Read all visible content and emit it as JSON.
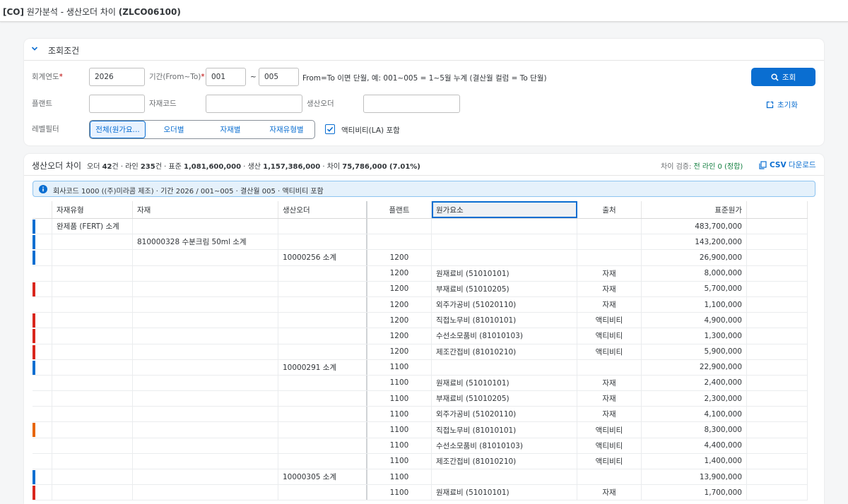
{
  "header": {
    "title_prefix": "[CO]",
    "title_main": " 원가분석 - 생산오더 차이 ",
    "title_code": "(ZLCO06100)"
  },
  "filters": {
    "section_title": "조회조건",
    "fiscal_year_label": "회계연도",
    "fiscal_year_value": "2026",
    "period_label": "기간(From~To)",
    "period_from": "001",
    "period_sep": "~",
    "period_to": "005",
    "period_hint": "From=To 이면 단월, 예: 001~005 = 1~5월 누계 (결산월 컬럼 = To 단월)",
    "plant_label": "플랜트",
    "plant_value": "",
    "material_label": "자재코드",
    "material_value": "",
    "order_label": "생산오더",
    "order_value": "",
    "level_label": "레벨필터",
    "level_options": [
      "전체(원가요...",
      "오더별",
      "자재별",
      "자재유형별"
    ],
    "activity_label": "액티비티(LA) 포함",
    "activity_checked": true,
    "search_label": "조회",
    "reset_label": "초기화"
  },
  "table": {
    "title": "생산오더 차이",
    "stats": {
      "order_label": "오더",
      "order_count": "42",
      "order_unit": "건 · 라인",
      "line_count": "235",
      "line_unit": "건 · 표준",
      "standard": "1,081,600,000",
      "prod_label": "· 생산",
      "production": "1,157,386,000",
      "diff_label": "· 차이",
      "difference": "75,786,000 (7.01%)"
    },
    "check_label": "차이 검증:",
    "check_value": "전 라인 0 (정합)",
    "csv_prefix": "CSV",
    "csv_label": " 다운로드",
    "info_text": "회사코드 1000 ((주)미라콤 제조) · 기간 2026 / 001~005 · 결산월 005 · 액티비티 포함",
    "columns": [
      "",
      "자재유형",
      "자재",
      "생산오더",
      "플랜트",
      "원가요소",
      "출처",
      "표준원가",
      ""
    ],
    "rows": [
      {
        "m": "blue",
        "c1": "완제품 (FERT) 소계",
        "c2": "",
        "c3": "",
        "c4": "",
        "c5": "",
        "c6": "",
        "c7": "483,700,000"
      },
      {
        "m": "blue",
        "c1": "",
        "c2": "810000328 수분크림 50ml 소계",
        "c3": "",
        "c4": "",
        "c5": "",
        "c6": "",
        "c7": "143,200,000"
      },
      {
        "m": "blue",
        "c1": "",
        "c2": "",
        "c3": "10000256 소계",
        "c4": "1200",
        "c5": "",
        "c6": "",
        "c7": "26,900,000"
      },
      {
        "m": "",
        "c1": "",
        "c2": "",
        "c3": "",
        "c4": "1200",
        "c5": "원재료비 (51010101)",
        "c6": "자재",
        "c7": "8,000,000"
      },
      {
        "m": "red",
        "c1": "",
        "c2": "",
        "c3": "",
        "c4": "1200",
        "c5": "부재료비 (51010205)",
        "c6": "자재",
        "c7": "5,700,000"
      },
      {
        "m": "",
        "c1": "",
        "c2": "",
        "c3": "",
        "c4": "1200",
        "c5": "외주가공비 (51020110)",
        "c6": "자재",
        "c7": "1,100,000"
      },
      {
        "m": "red",
        "c1": "",
        "c2": "",
        "c3": "",
        "c4": "1200",
        "c5": "직접노무비 (81010101)",
        "c6": "액티비티",
        "c7": "4,900,000"
      },
      {
        "m": "red",
        "c1": "",
        "c2": "",
        "c3": "",
        "c4": "1200",
        "c5": "수선소모품비 (81010103)",
        "c6": "액티비티",
        "c7": "1,300,000"
      },
      {
        "m": "red",
        "c1": "",
        "c2": "",
        "c3": "",
        "c4": "1200",
        "c5": "제조간접비 (81010210)",
        "c6": "액티비티",
        "c7": "5,900,000"
      },
      {
        "m": "blue",
        "c1": "",
        "c2": "",
        "c3": "10000291 소계",
        "c4": "1100",
        "c5": "",
        "c6": "",
        "c7": "22,900,000"
      },
      {
        "m": "",
        "c1": "",
        "c2": "",
        "c3": "",
        "c4": "1100",
        "c5": "원재료비 (51010101)",
        "c6": "자재",
        "c7": "2,400,000"
      },
      {
        "m": "",
        "c1": "",
        "c2": "",
        "c3": "",
        "c4": "1100",
        "c5": "부재료비 (51010205)",
        "c6": "자재",
        "c7": "2,300,000"
      },
      {
        "m": "",
        "c1": "",
        "c2": "",
        "c3": "",
        "c4": "1100",
        "c5": "외주가공비 (51020110)",
        "c6": "자재",
        "c7": "4,100,000"
      },
      {
        "m": "orange",
        "c1": "",
        "c2": "",
        "c3": "",
        "c4": "1100",
        "c5": "직접노무비 (81010101)",
        "c6": "액티비티",
        "c7": "8,300,000"
      },
      {
        "m": "",
        "c1": "",
        "c2": "",
        "c3": "",
        "c4": "1100",
        "c5": "수선소모품비 (81010103)",
        "c6": "액티비티",
        "c7": "4,400,000"
      },
      {
        "m": "",
        "c1": "",
        "c2": "",
        "c3": "",
        "c4": "1100",
        "c5": "제조간접비 (81010210)",
        "c6": "액티비티",
        "c7": "1,400,000"
      },
      {
        "m": "blue",
        "c1": "",
        "c2": "",
        "c3": "10000305 소계",
        "c4": "1100",
        "c5": "",
        "c6": "",
        "c7": "13,900,000"
      },
      {
        "m": "red",
        "c1": "",
        "c2": "",
        "c3": "",
        "c4": "1100",
        "c5": "원재료비 (51010101)",
        "c6": "자재",
        "c7": "1,700,000"
      }
    ]
  },
  "colors": {
    "accent": "#0a6ed1",
    "marker_blue": "#0a6ed1",
    "marker_red": "#d9261c",
    "marker_orange": "#e76500",
    "ok_green": "#107e3e"
  }
}
